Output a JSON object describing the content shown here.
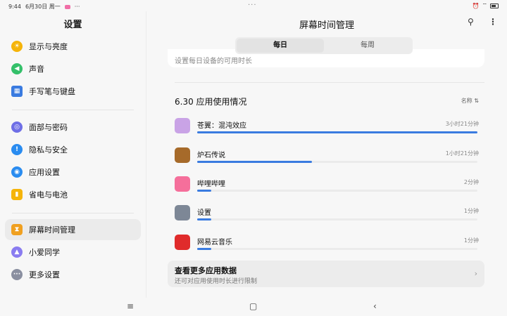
{
  "status": {
    "time": "9:44",
    "date": "6月30日 周一",
    "more": "···"
  },
  "top_dots": "···",
  "sidebar": {
    "title": "设置",
    "items": [
      {
        "label": "显示与亮度",
        "icon": "sun-icon",
        "color": "#f5b40a",
        "glyph": "☀"
      },
      {
        "label": "声音",
        "icon": "speaker-icon",
        "color": "#34c06a",
        "glyph": "🔈"
      },
      {
        "label": "手写笔与键盘",
        "icon": "keyboard-icon",
        "color": "#3a7be0",
        "glyph": "⌨"
      },
      {
        "label": "面部与密码",
        "icon": "face-icon",
        "color": "#6f6fe6",
        "glyph": "◎"
      },
      {
        "label": "隐私与安全",
        "icon": "shield-icon",
        "color": "#2a8cf0",
        "glyph": "!"
      },
      {
        "label": "应用设置",
        "icon": "apps-icon",
        "color": "#2a8cf0",
        "glyph": "◉"
      },
      {
        "label": "省电与电池",
        "icon": "battery-icon",
        "color": "#f5b40a",
        "glyph": "▮"
      },
      {
        "label": "屏幕时间管理",
        "icon": "hourglass-icon",
        "color": "#f0a020",
        "glyph": "⌛"
      },
      {
        "label": "小爱同学",
        "icon": "assistant-icon",
        "color": "#8a7cf0",
        "glyph": "▲"
      },
      {
        "label": "更多设置",
        "icon": "more-icon",
        "color": "#8a8fa0",
        "glyph": "···"
      }
    ]
  },
  "main": {
    "title": "屏幕时间管理",
    "tabs": [
      {
        "label": "每日"
      },
      {
        "label": "每周"
      }
    ],
    "top_card_text": "设置每日设备的可用时长",
    "usage_title": "6.30 应用使用情况",
    "sort_label": "名称 ⇅",
    "apps": [
      {
        "name": "苍翼：混沌效应",
        "time": "3小时21分钟",
        "fraction": 1.0,
        "icon": "game-blazblue-icon",
        "color": "#c9a3e6"
      },
      {
        "name": "炉石传说",
        "time": "1小时21分钟",
        "fraction": 0.41,
        "icon": "hearthstone-icon",
        "color": "#a66a2a"
      },
      {
        "name": "哔哩哔哩",
        "time": "2分钟",
        "fraction": 0.05,
        "icon": "bilibili-icon",
        "color": "#f56f9b"
      },
      {
        "name": "设置",
        "time": "1分钟",
        "fraction": 0.05,
        "icon": "settings-icon",
        "color": "#7d8796"
      },
      {
        "name": "网易云音乐",
        "time": "1分钟",
        "fraction": 0.05,
        "icon": "netease-music-icon",
        "color": "#e02b2b"
      }
    ],
    "more": {
      "title": "查看更多应用数据",
      "subtitle": "还可对应用使用时长进行限制",
      "arrow": "›"
    }
  },
  "nav": {
    "menu": "≡",
    "home": "▢",
    "back": "‹"
  }
}
